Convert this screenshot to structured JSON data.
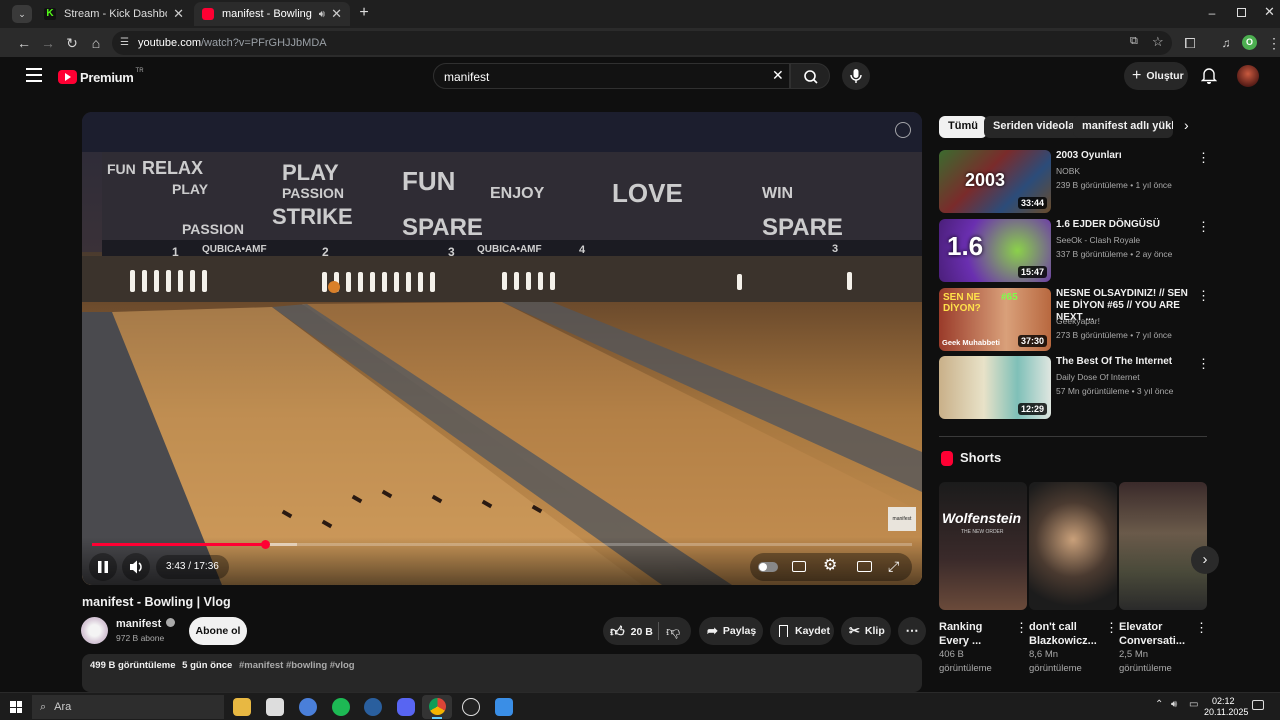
{
  "browser": {
    "tabs": [
      {
        "label": "Stream - Kick Dashboard",
        "icon": "kick-icon"
      },
      {
        "label": "manifest - Bowling | Vlog",
        "icon": "youtube-icon"
      }
    ],
    "url_host": "youtube.com",
    "url_path": "/watch?v=PFrGHJJbMDA",
    "profile_letter": "O"
  },
  "youtube": {
    "logo": "Premium",
    "logo_sup": "TR",
    "search_value": "manifest",
    "create_label": "Oluştur"
  },
  "video": {
    "time": "3:43 / 17:36",
    "progress": 0.211,
    "title": "manifest - Bowling | Vlog",
    "channel": "manifest",
    "subscribers": "972 B abone",
    "subscribe_label": "Abone ol",
    "likes": "20 B",
    "share_label": "Paylaş",
    "save_label": "Kaydet",
    "clip_label": "Klip",
    "views": "499 B görüntüleme",
    "date": "5 gün önce",
    "tags": "#manifest #bowling #vlog",
    "brand_colors": {
      "accent": "#ff0033",
      "background": "#0f0f0f"
    },
    "scene_banner": [
      "FUN",
      "RELAX",
      "PLAY",
      "PASSION",
      "STRIKE",
      "FUN",
      "SPARE",
      "ENJOY",
      "LOVE",
      "WIN",
      "PLAY",
      "PASSION",
      "SPARE"
    ],
    "lane_numbers": [
      "1",
      "2",
      "3",
      "4",
      "3"
    ],
    "brand_text": "QUBICA•AMF",
    "watermark": "manifest"
  },
  "sidebar": {
    "chips": [
      "Tümü",
      "Seriden videolar",
      "manifest adlı yükleyici"
    ],
    "recommendations": [
      {
        "title": "2003 Oyunları",
        "channel": "NOBK",
        "meta": "239 B görüntüleme • 1 yıl önce",
        "duration": "33:44",
        "thumb_text": "2003"
      },
      {
        "title": "1.6 EJDER DÖNGÜSÜ",
        "channel": "SeeOk - Clash Royale",
        "meta": "337 B görüntüleme • 2 ay önce",
        "duration": "15:47",
        "thumb_text": "1.6"
      },
      {
        "title": "NESNE OLSAYDINIZ! // SEN NE DİYON #65 // YOU ARE NEXT ...",
        "channel": "Geekyapar!",
        "meta": "273 B görüntüleme • 7 yıl önce",
        "duration": "37:30",
        "thumb_text": "SEN NE DİYON?",
        "thumb_sub": "Geek Muhabbeti",
        "thumb_num": "#65"
      },
      {
        "title": "The Best Of The Internet",
        "channel": "Daily Dose Of Internet",
        "meta": "57 Mn görüntüleme • 3 yıl önce",
        "duration": "12:29",
        "thumb_text": ""
      }
    ],
    "shorts_title": "Shorts",
    "shorts": [
      {
        "title": "Ranking Every ...",
        "views": "406 B görüntüleme",
        "thumb_text": "Wolfenstein",
        "thumb_sub": "THE NEW ORDER"
      },
      {
        "title": "don't call Blazkowicz...",
        "views": "8,6 Mn görüntüleme",
        "thumb_text": ""
      },
      {
        "title": "Elevator Conversati...",
        "views": "2,5 Mn görüntüleme",
        "thumb_text": ""
      }
    ]
  },
  "taskbar": {
    "search_placeholder": "Ara",
    "time": "02:12",
    "date": "20.11.2025"
  }
}
